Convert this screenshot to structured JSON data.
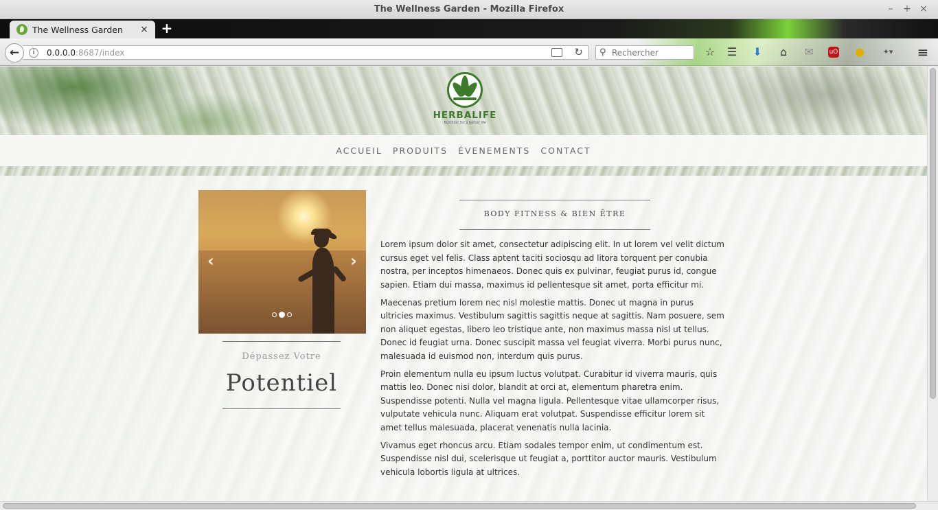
{
  "window": {
    "title": "The Wellness Garden - Mozilla Firefox",
    "minimize": "–",
    "maximize": "+",
    "close": "×"
  },
  "tabs": [
    {
      "label": "The Wellness Garden",
      "close": "×"
    }
  ],
  "new_tab": "+",
  "navbar": {
    "url_host": "0.0.0.0",
    "url_rest": ":8687/index",
    "search_placeholder": "Rechercher",
    "icons": [
      "back-icon",
      "info-icon",
      "reader-view-icon",
      "reload-icon",
      "search-icon",
      "bookmark-star-icon",
      "reading-list-icon",
      "download-icon",
      "home-icon",
      "pocket-icon",
      "ublock-icon",
      "extension-icon",
      "dropdown-icon",
      "hamburger-menu-icon"
    ]
  },
  "site": {
    "brand": "HERBALIFE",
    "tagline": "Nutrition for a better life",
    "menu": [
      "ACCUEIL",
      "PRODUITS",
      "ÉVENEMENTS",
      "CONTACT"
    ],
    "slider": {
      "dots": 3,
      "active_dot": 2
    },
    "potential_small": "Dépassez Votre",
    "potential_big": "Potentiel",
    "heading": "BODY FITNESS & BIEN ÊTRE",
    "paragraphs": [
      "Lorem ipsum dolor sit amet, consectetur adipiscing elit. In ut lorem vel velit dictum cursus eget vel felis. Class aptent taciti sociosqu ad litora torquent per conubia nostra, per inceptos himenaeos. Donec quis ex pulvinar, feugiat purus id, congue sapien. Etiam dui massa, maximus id pellentesque sit amet, porta efficitur mi.",
      "Maecenas pretium lorem nec nisl molestie mattis. Donec ut magna in purus ultricies maximus. Vestibulum sagittis sagittis neque at sagittis. Nam posuere, sem non aliquet egestas, libero leo tristique ante, non maximus massa nisl ut tellus. Donec id feugiat urna. Donec suscipit massa vel feugiat viverra. Morbi purus nunc, malesuada id euismod non, interdum quis purus.",
      "Proin elementum nulla eu ipsum luctus volutpat. Curabitur id viverra mauris, quis mattis leo. Donec nisi dolor, blandit at orci at, elementum pharetra enim. Suspendisse potenti. Nulla vel magna ligula. Pellentesque vitae ullamcorper risus, vulputate vehicula nunc. Aliquam erat volutpat. Suspendisse efficitur lorem sit amet tellus malesuada, placerat venenatis nulla lacinia.",
      "Vivamus eget rhoncus arcu. Etiam sodales tempor enim, ut condimentum est. Suspendisse nisl dui, scelerisque ut feugiat a, porttitor auctor mauris. Vestibulum vehicula lobortis ligula at ultrices."
    ]
  },
  "colors": {
    "brand_green": "#3d7a2c",
    "menu_text": "#666666",
    "body_text": "#333333"
  }
}
